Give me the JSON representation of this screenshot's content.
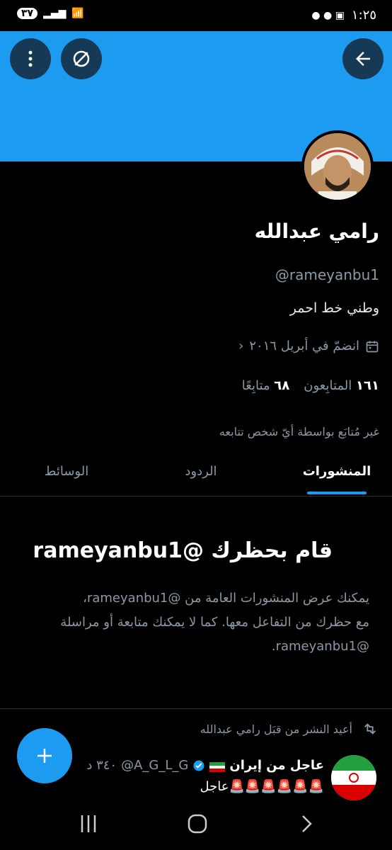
{
  "status": {
    "battery": "٣٧",
    "time": "١:٢٥",
    "network": "4G"
  },
  "profile": {
    "name": "رامي عبدالله",
    "handle": "@rameyanbu1",
    "bio": "وطني خط احمر",
    "joined": "انضمّ في أبريل ٢٠١٦",
    "followers_count": "١٦١",
    "followers_label": "المتابِعون",
    "following_count": "٦٨",
    "following_label": "متابِعًا",
    "not_followed": "غير مُتابَع بواسطة أيّ شخص تتابعه"
  },
  "tabs": [
    {
      "label": "المنشورات",
      "active": true
    },
    {
      "label": "الردود",
      "active": false
    },
    {
      "label": "الوسائط",
      "active": false
    }
  ],
  "blocked": {
    "title": "قام بحظرك @rameyanbu1",
    "line1": "يمكنك عرض المنشورات العامة من @rameyanbu1،",
    "line2": "مع حظرك من التفاعل معها. كما لا يمكنك متابعة أو مراسلة",
    "line3": "@rameyanbu1."
  },
  "post": {
    "repost_label": "أعيد النشر من قبَل رامي عبدالله",
    "author": "عاجل من إيران",
    "author_handle": "@A_G_L_G",
    "time": "٣٤٠ د",
    "text": "🚨🚨🚨🚨🚨🚨عاجل"
  },
  "colors": {
    "accent": "#1d9bf0",
    "banner": "#1d9bf0",
    "background": "#000000",
    "muted": "#8b98a5"
  },
  "icons": [
    "back-arrow-icon",
    "grok-icon",
    "more-vertical-icon",
    "calendar-icon",
    "chevron-icon",
    "repost-icon",
    "verified-icon",
    "plus-icon"
  ]
}
